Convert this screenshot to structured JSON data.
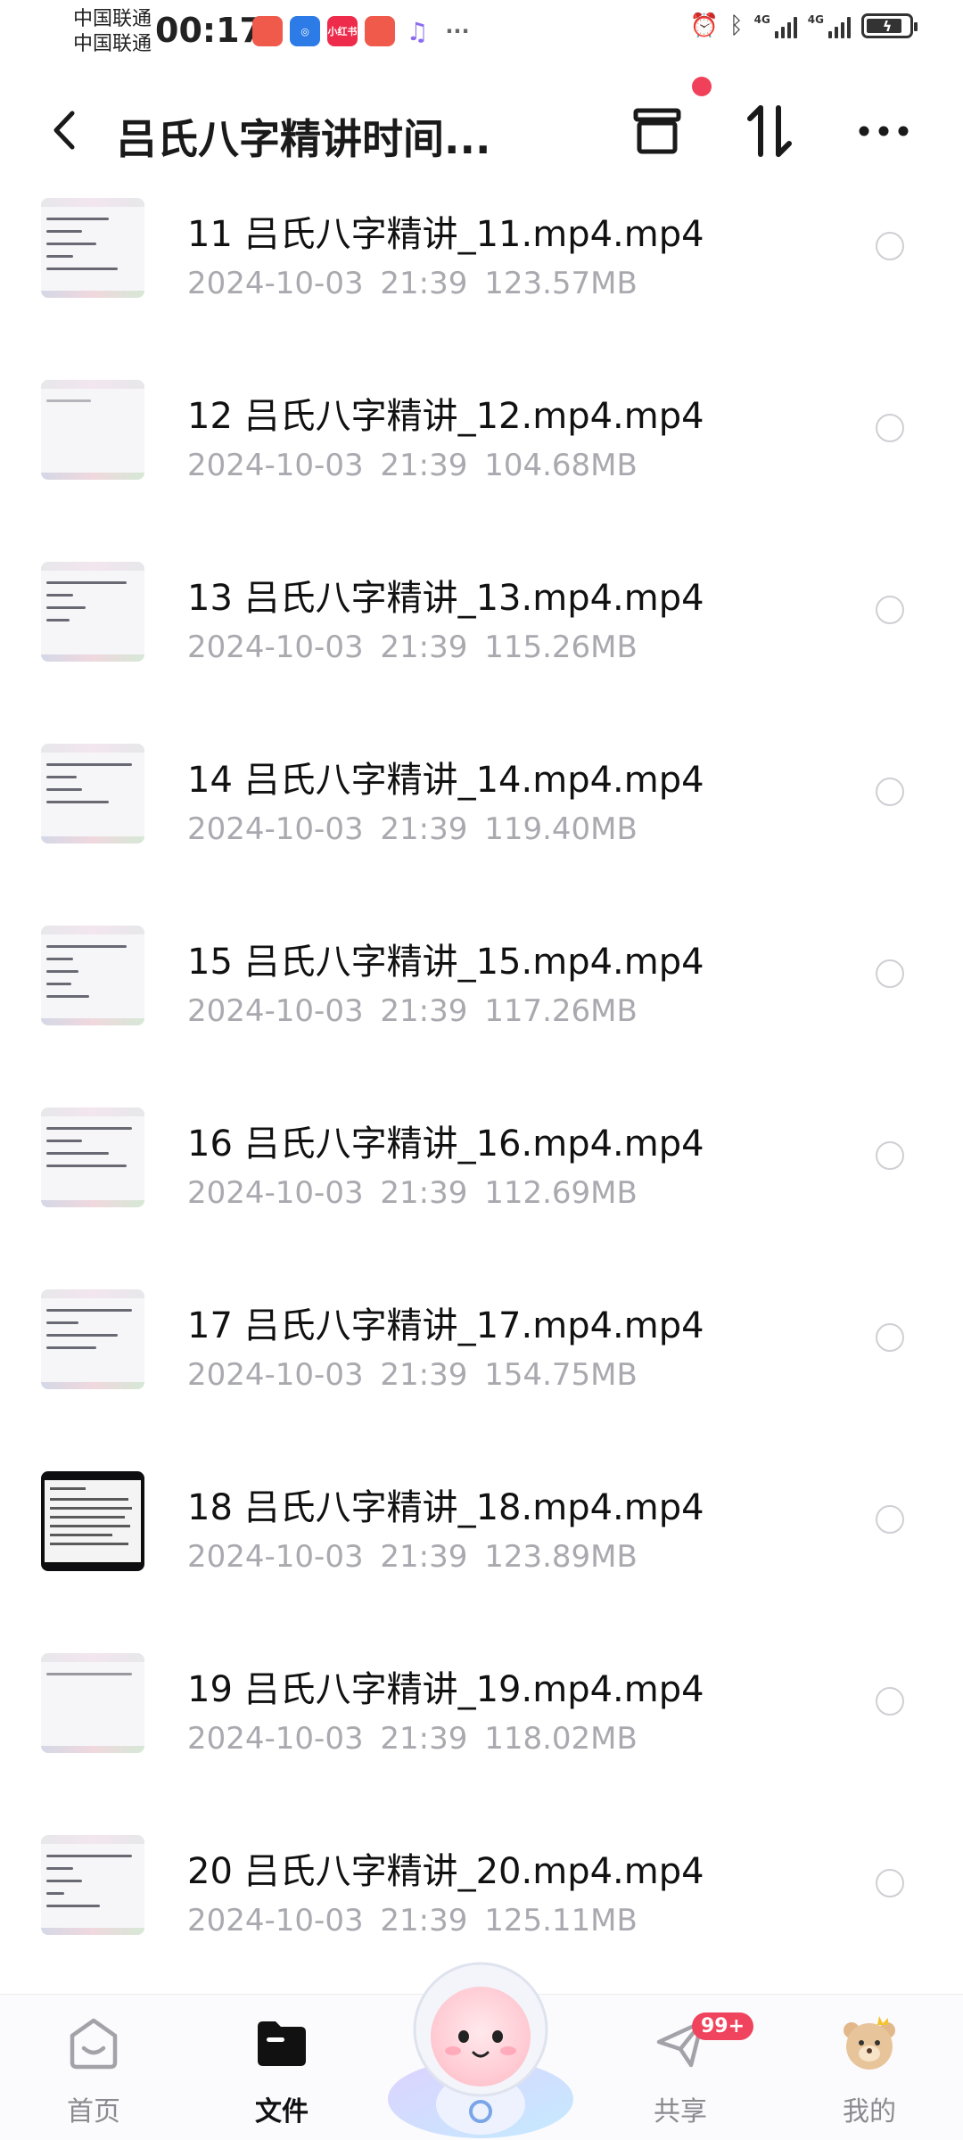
{
  "status_bar": {
    "carrier_1": "中国联通",
    "carrier_2": "中国联通",
    "time": "00:17",
    "app_icons": [
      "app-icon-red",
      "app-icon-blue",
      "xiaohongshu-icon",
      "app-icon-red",
      "music-icon"
    ],
    "xiaohongshu_label": "小红书",
    "more": "···",
    "network_1": "4G",
    "network_2": "4G"
  },
  "header": {
    "title": "吕氏八字精讲时间...",
    "back_icon": "chevron-left-icon",
    "archive_icon": "archive-box-icon",
    "sort_icon": "sort-arrows-icon",
    "more_icon": "more-dots-icon",
    "notification_dot_color": "#f1405a"
  },
  "files": [
    {
      "name": "11 吕氏八字精讲_11.mp4.mp4",
      "meta": "2024-10-03  21:39  123.57MB"
    },
    {
      "name": "12 吕氏八字精讲_12.mp4.mp4",
      "meta": "2024-10-03  21:39  104.68MB"
    },
    {
      "name": "13 吕氏八字精讲_13.mp4.mp4",
      "meta": "2024-10-03  21:39  115.26MB"
    },
    {
      "name": "14 吕氏八字精讲_14.mp4.mp4",
      "meta": "2024-10-03  21:39  119.40MB"
    },
    {
      "name": "15 吕氏八字精讲_15.mp4.mp4",
      "meta": "2024-10-03  21:39  117.26MB"
    },
    {
      "name": "16 吕氏八字精讲_16.mp4.mp4",
      "meta": "2024-10-03  21:39  112.69MB"
    },
    {
      "name": "17 吕氏八字精讲_17.mp4.mp4",
      "meta": "2024-10-03  21:39  154.75MB"
    },
    {
      "name": "18 吕氏八字精讲_18.mp4.mp4",
      "meta": "2024-10-03  21:39  123.89MB"
    },
    {
      "name": "19 吕氏八字精讲_19.mp4.mp4",
      "meta": "2024-10-03  21:39  118.02MB"
    },
    {
      "name": "20 吕氏八字精讲_20.mp4.mp4",
      "meta": "2024-10-03  21:39  125.11MB"
    }
  ],
  "bottom_nav": {
    "home": "首页",
    "files": "文件",
    "share": "共享",
    "share_badge": "99+",
    "mine": "我的",
    "active": "files",
    "accent_color": "#f0435d"
  }
}
